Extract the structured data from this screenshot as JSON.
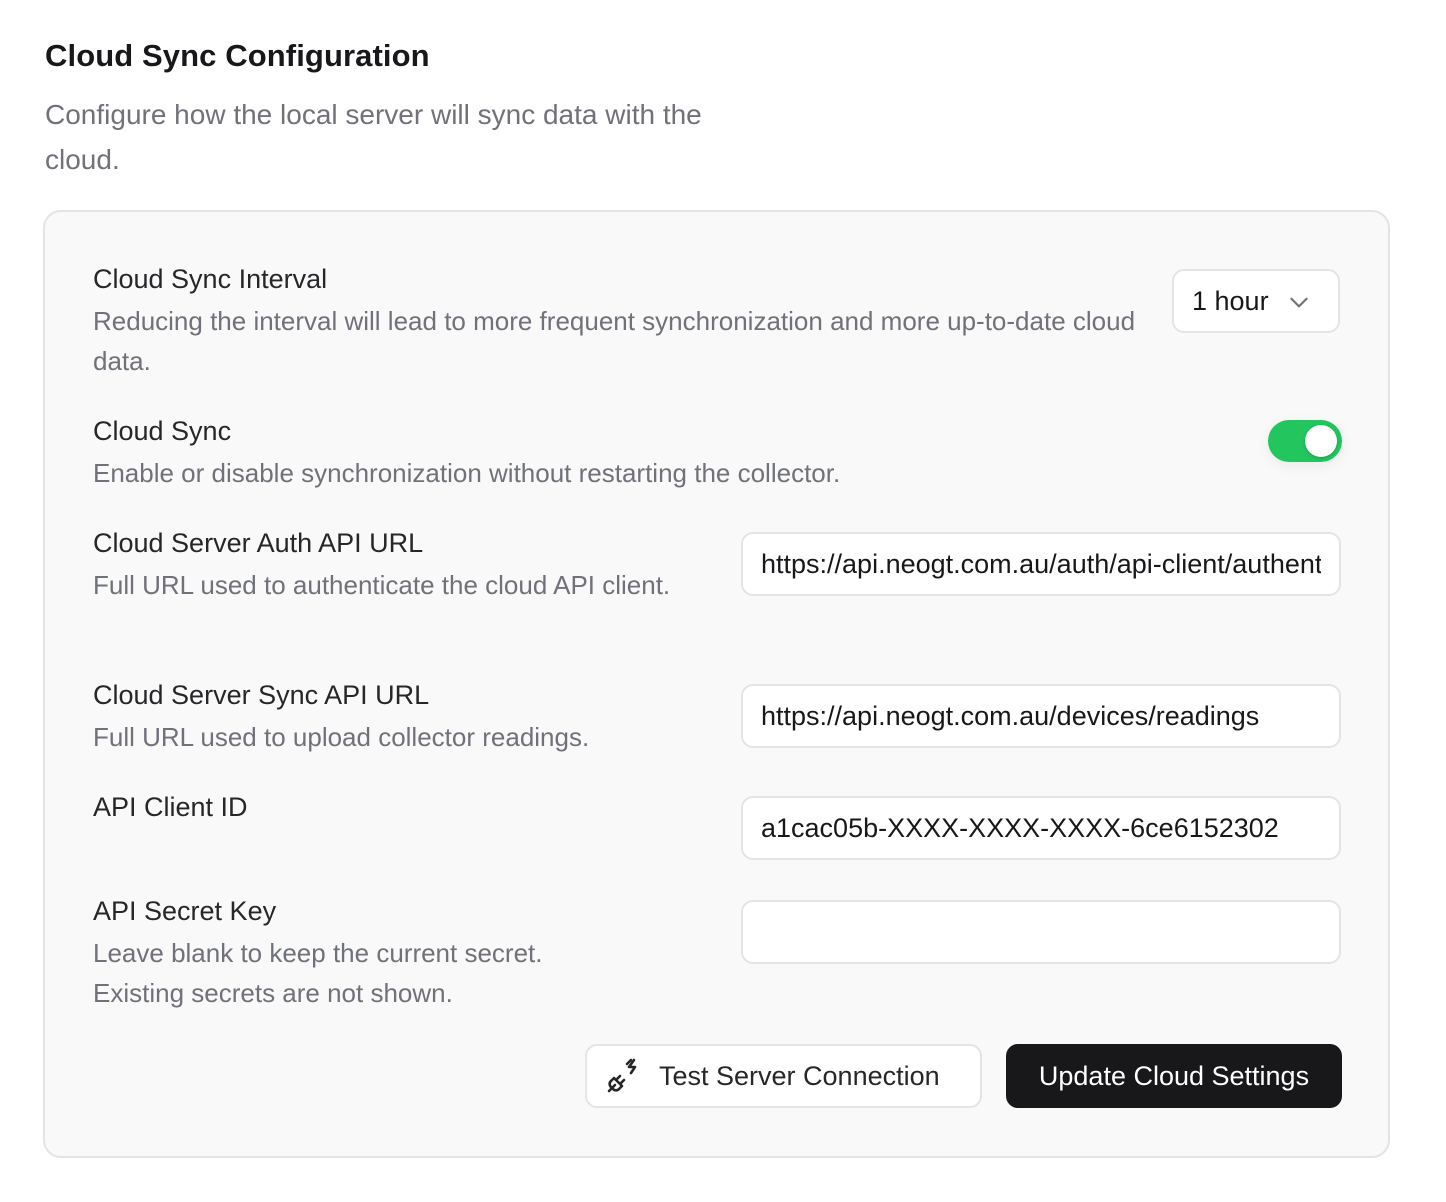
{
  "section": {
    "title": "Cloud Sync Configuration",
    "description": "Configure how the local server will sync data with the cloud."
  },
  "settings": {
    "interval": {
      "label": "Cloud Sync Interval",
      "help": "Reducing the interval will lead to more frequent synchronization and more up-to-date cloud data.",
      "selected": "1 hour",
      "icon": "chevron-down-icon"
    },
    "sync": {
      "label": "Cloud Sync",
      "help": "Enable or disable synchronization without restarting the collector.",
      "enabled": true,
      "accent": "#22c55e"
    },
    "auth_url": {
      "label": "Cloud Server Auth API URL",
      "help": "Full URL used to authenticate the cloud API client.",
      "value": "https://api.neogt.com.au/auth/api-client/authenticate"
    },
    "sync_url": {
      "label": "Cloud Server Sync API URL",
      "help": "Full URL used to upload collector readings.",
      "value": "https://api.neogt.com.au/devices/readings"
    },
    "client_id": {
      "label": "API Client ID",
      "value": "a1cac05b-XXXX-XXXX-XXXX-6ce6152302"
    },
    "secret": {
      "label": "API Secret Key",
      "help": "Leave blank to keep the current secret. Existing secrets are not shown.",
      "value": ""
    }
  },
  "actions": {
    "test_label": "Test Server Connection",
    "test_icon": "plug-icon",
    "update_label": "Update Cloud Settings"
  }
}
